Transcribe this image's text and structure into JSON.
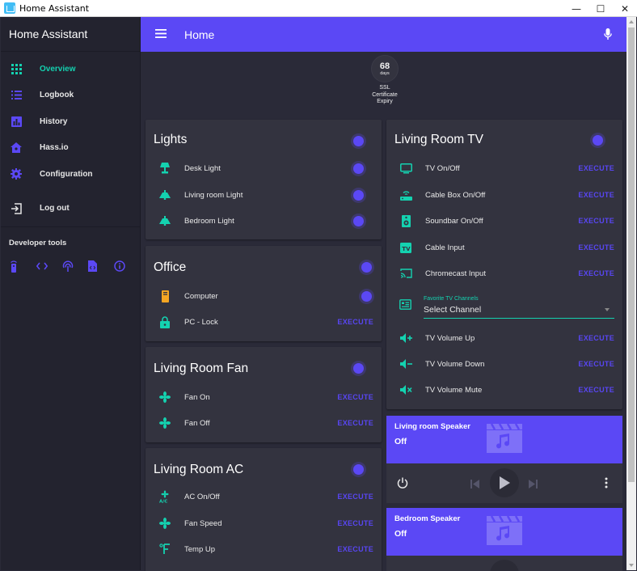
{
  "window": {
    "title": "Home Assistant",
    "controls": [
      "—",
      "☐",
      "✕"
    ]
  },
  "sidebar": {
    "brand": "Home Assistant",
    "items": [
      {
        "label": "Overview",
        "icon": "apps-icon",
        "active": true
      },
      {
        "label": "Logbook",
        "icon": "list-icon"
      },
      {
        "label": "History",
        "icon": "chart-icon"
      },
      {
        "label": "Hass.io",
        "icon": "hassio-icon"
      },
      {
        "label": "Configuration",
        "icon": "gear-icon"
      },
      {
        "label": "Log out",
        "icon": "logout-icon"
      }
    ],
    "dev_tools": {
      "title": "Developer tools",
      "icons": [
        "remote-icon",
        "code-icon",
        "broadcast-icon",
        "file-code-icon",
        "info-icon"
      ]
    }
  },
  "header": {
    "title": "Home",
    "menu_icon": "menu-icon",
    "mic_icon": "microphone-icon"
  },
  "badge": {
    "value": "68",
    "unit": "days",
    "label": "SSL Certificate Expiry"
  },
  "colors": {
    "accent": "#5b48f5",
    "teal": "#14d2b0",
    "card": "#33333f",
    "background": "#2a2a38",
    "sidebar": "#23232f"
  },
  "cards": {
    "lights": {
      "title": "Lights",
      "rows": [
        {
          "name": "Desk Light",
          "icon": "desk-lamp-icon"
        },
        {
          "name": "Living room Light",
          "icon": "ceiling-light-icon"
        },
        {
          "name": "Bedroom Light",
          "icon": "ceiling-light-icon"
        }
      ]
    },
    "office": {
      "title": "Office",
      "rows": [
        {
          "name": "Computer",
          "icon": "desktop-tower-icon"
        },
        {
          "name": "PC - Lock",
          "icon": "lock-icon",
          "action": "EXECUTE"
        }
      ]
    },
    "fan": {
      "title": "Living Room Fan",
      "rows": [
        {
          "name": "Fan On",
          "icon": "fan-icon",
          "action": "EXECUTE"
        },
        {
          "name": "Fan Off",
          "icon": "fan-icon",
          "action": "EXECUTE"
        }
      ]
    },
    "ac": {
      "title": "Living Room AC",
      "rows": [
        {
          "name": "AC On/Off",
          "icon": "air-conditioner-icon",
          "action": "EXECUTE"
        },
        {
          "name": "Fan Speed",
          "icon": "fan-icon",
          "action": "EXECUTE"
        },
        {
          "name": "Temp Up",
          "icon": "fahrenheit-icon",
          "action": "EXECUTE"
        }
      ]
    },
    "tv": {
      "title": "Living Room TV",
      "rows": [
        {
          "name": "TV On/Off",
          "icon": "television-icon",
          "action": "EXECUTE"
        },
        {
          "name": "Cable Box On/Off",
          "icon": "router-icon",
          "action": "EXECUTE"
        },
        {
          "name": "Soundbar On/Off",
          "icon": "speaker-icon",
          "action": "EXECUTE"
        },
        {
          "name": "Cable Input",
          "icon": "tv-box-icon",
          "action": "EXECUTE"
        },
        {
          "name": "Chromecast Input",
          "icon": "cast-icon",
          "action": "EXECUTE"
        }
      ],
      "select": {
        "label": "Favorite TV Channels",
        "value": "Select Channel",
        "icon": "guide-icon"
      },
      "volume_rows": [
        {
          "name": "TV Volume Up",
          "icon": "volume-plus-icon",
          "action": "EXECUTE"
        },
        {
          "name": "TV Volume Down",
          "icon": "volume-minus-icon",
          "action": "EXECUTE"
        },
        {
          "name": "TV Volume Mute",
          "icon": "volume-mute-icon",
          "action": "EXECUTE"
        }
      ]
    },
    "speaker_living": {
      "title": "Living room Speaker",
      "state": "Off",
      "icon": "music-video-icon"
    },
    "speaker_bedroom": {
      "title": "Bedroom Speaker",
      "state": "Off",
      "icon": "music-video-icon"
    }
  }
}
